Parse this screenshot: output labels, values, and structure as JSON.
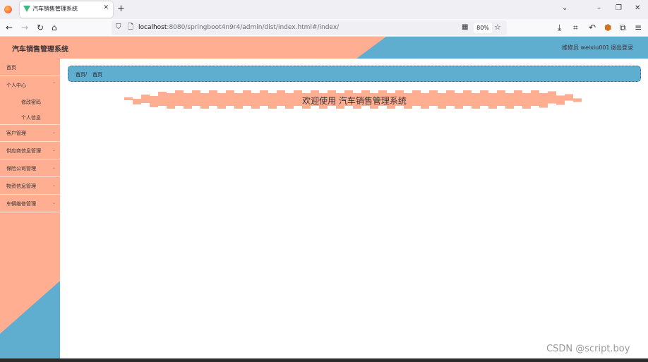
{
  "browser": {
    "tab_title": "汽车销售管理系统",
    "new_tab_symbol": "+",
    "url_host": "localhost",
    "url_rest": ":8080/springboot4n9r4/admin/dist/index.html#/index/",
    "zoom": "80%"
  },
  "header": {
    "title": "汽车销售管理系统",
    "user": "维修员 weixiu001",
    "logout_label": "退出登录"
  },
  "sidebar": {
    "items": [
      {
        "label": "首页"
      },
      {
        "label": "个人中心",
        "arrow": "⌄"
      },
      {
        "label": "客户管理",
        "arrow": "⌄"
      },
      {
        "label": "供应商信息管理",
        "arrow": "⌄"
      },
      {
        "label": "保险公司管理",
        "arrow": "⌄"
      },
      {
        "label": "物资信息管理",
        "arrow": "⌄"
      },
      {
        "label": "车辆维修管理",
        "arrow": "⌄"
      }
    ],
    "sub_items": [
      {
        "label": "修改密码"
      },
      {
        "label": "个人信息"
      }
    ]
  },
  "breadcrumb": {
    "items": [
      "首页",
      "首页"
    ],
    "separator": "/"
  },
  "main": {
    "welcome": "欢迎使用 汽车销售管理系统"
  },
  "watermark": "CSDN @script.boy",
  "colors": {
    "salmon": "#ffae91",
    "blue": "#5fadcf"
  }
}
